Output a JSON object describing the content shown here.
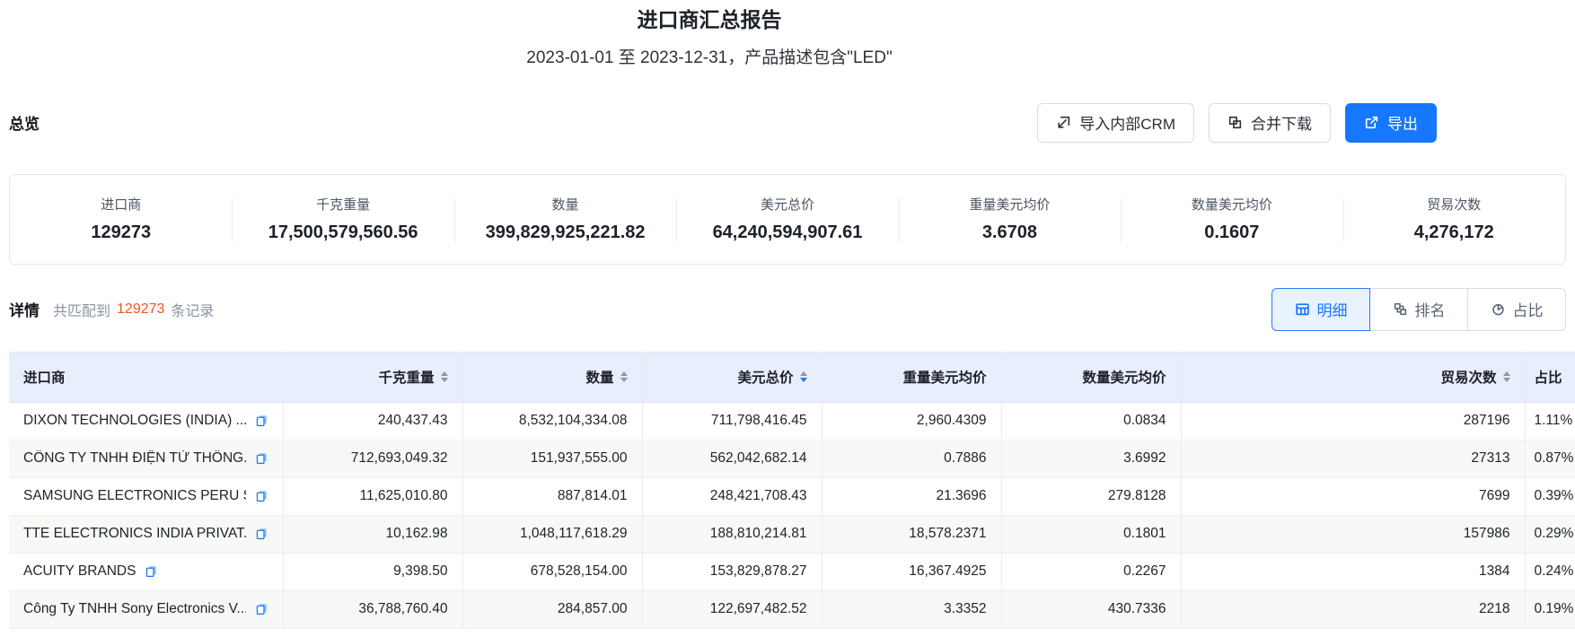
{
  "header": {
    "title": "进口商汇总报告",
    "subtitle": "2023-01-01 至 2023-12-31，产品描述包含\"LED\""
  },
  "overview": {
    "heading": "总览",
    "buttons": {
      "import_crm": {
        "label": "导入内部CRM",
        "icon": "import-icon"
      },
      "merge_download": {
        "label": "合并下载",
        "icon": "merge-icon"
      },
      "export": {
        "label": "导出",
        "icon": "export-icon"
      }
    },
    "stats": [
      {
        "label": "进口商",
        "value": "129273"
      },
      {
        "label": "千克重量",
        "value": "17,500,579,560.56"
      },
      {
        "label": "数量",
        "value": "399,829,925,221.82"
      },
      {
        "label": "美元总价",
        "value": "64,240,594,907.61"
      },
      {
        "label": "重量美元均价",
        "value": "3.6708"
      },
      {
        "label": "数量美元均价",
        "value": "0.1607"
      },
      {
        "label": "贸易次数",
        "value": "4,276,172"
      }
    ]
  },
  "details": {
    "heading": "详情",
    "match_prefix": "共匹配到",
    "match_count": "129273",
    "match_suffix": "条记录",
    "view_tabs": [
      {
        "label": "明细",
        "icon": "table-icon",
        "selected": true
      },
      {
        "label": "排名",
        "icon": "ranking-icon",
        "selected": false
      },
      {
        "label": "占比",
        "icon": "pie-icon",
        "selected": false
      }
    ]
  },
  "table": {
    "columns": [
      {
        "key": "importer",
        "label": "进口商",
        "align": "left",
        "sortable": false
      },
      {
        "key": "kg",
        "label": "千克重量",
        "align": "right",
        "sortable": true,
        "sort": null
      },
      {
        "key": "qty",
        "label": "数量",
        "align": "right",
        "sortable": true,
        "sort": null
      },
      {
        "key": "usd",
        "label": "美元总价",
        "align": "right",
        "sortable": true,
        "sort": "desc"
      },
      {
        "key": "usd_per_kg",
        "label": "重量美元均价",
        "align": "right",
        "sortable": false
      },
      {
        "key": "usd_per_qty",
        "label": "数量美元均价",
        "align": "right",
        "sortable": false
      },
      {
        "key": "trades",
        "label": "贸易次数",
        "align": "right",
        "sortable": true,
        "sort": null
      },
      {
        "key": "share",
        "label": "占比",
        "align": "left",
        "sortable": false
      }
    ],
    "rows": [
      {
        "importer": "DIXON TECHNOLOGIES (INDIA) ...",
        "kg": "240,437.43",
        "qty": "8,532,104,334.08",
        "usd": "711,798,416.45",
        "usd_per_kg": "2,960.4309",
        "usd_per_qty": "0.0834",
        "trades": "287196",
        "share": "1.11%"
      },
      {
        "importer": "CÔNG TY TNHH ĐIỆN TỬ THÔNG...",
        "kg": "712,693,049.32",
        "qty": "151,937,555.00",
        "usd": "562,042,682.14",
        "usd_per_kg": "0.7886",
        "usd_per_qty": "3.6992",
        "trades": "27313",
        "share": "0.87%"
      },
      {
        "importer": "SAMSUNG ELECTRONICS PERU S...",
        "kg": "11,625,010.80",
        "qty": "887,814.01",
        "usd": "248,421,708.43",
        "usd_per_kg": "21.3696",
        "usd_per_qty": "279.8128",
        "trades": "7699",
        "share": "0.39%"
      },
      {
        "importer": "TTE ELECTRONICS INDIA PRIVAT...",
        "kg": "10,162.98",
        "qty": "1,048,117,618.29",
        "usd": "188,810,214.81",
        "usd_per_kg": "18,578.2371",
        "usd_per_qty": "0.1801",
        "trades": "157986",
        "share": "0.29%"
      },
      {
        "importer": "ACUITY BRANDS",
        "kg": "9,398.50",
        "qty": "678,528,154.00",
        "usd": "153,829,878.27",
        "usd_per_kg": "16,367.4925",
        "usd_per_qty": "0.2267",
        "trades": "1384",
        "share": "0.24%"
      },
      {
        "importer": "Công Ty TNHH Sony Electronics V...",
        "kg": "36,788,760.40",
        "qty": "284,857.00",
        "usd": "122,697,482.52",
        "usd_per_kg": "3.3352",
        "usd_per_qty": "430.7336",
        "trades": "2218",
        "share": "0.19%"
      }
    ],
    "row_icon": "copy-icon"
  },
  "colors": {
    "primary": "#1677ff",
    "count_highlight": "#f4541c",
    "table_header_bg": "#e9eefc",
    "stripe_bg": "#f6f9f6"
  }
}
